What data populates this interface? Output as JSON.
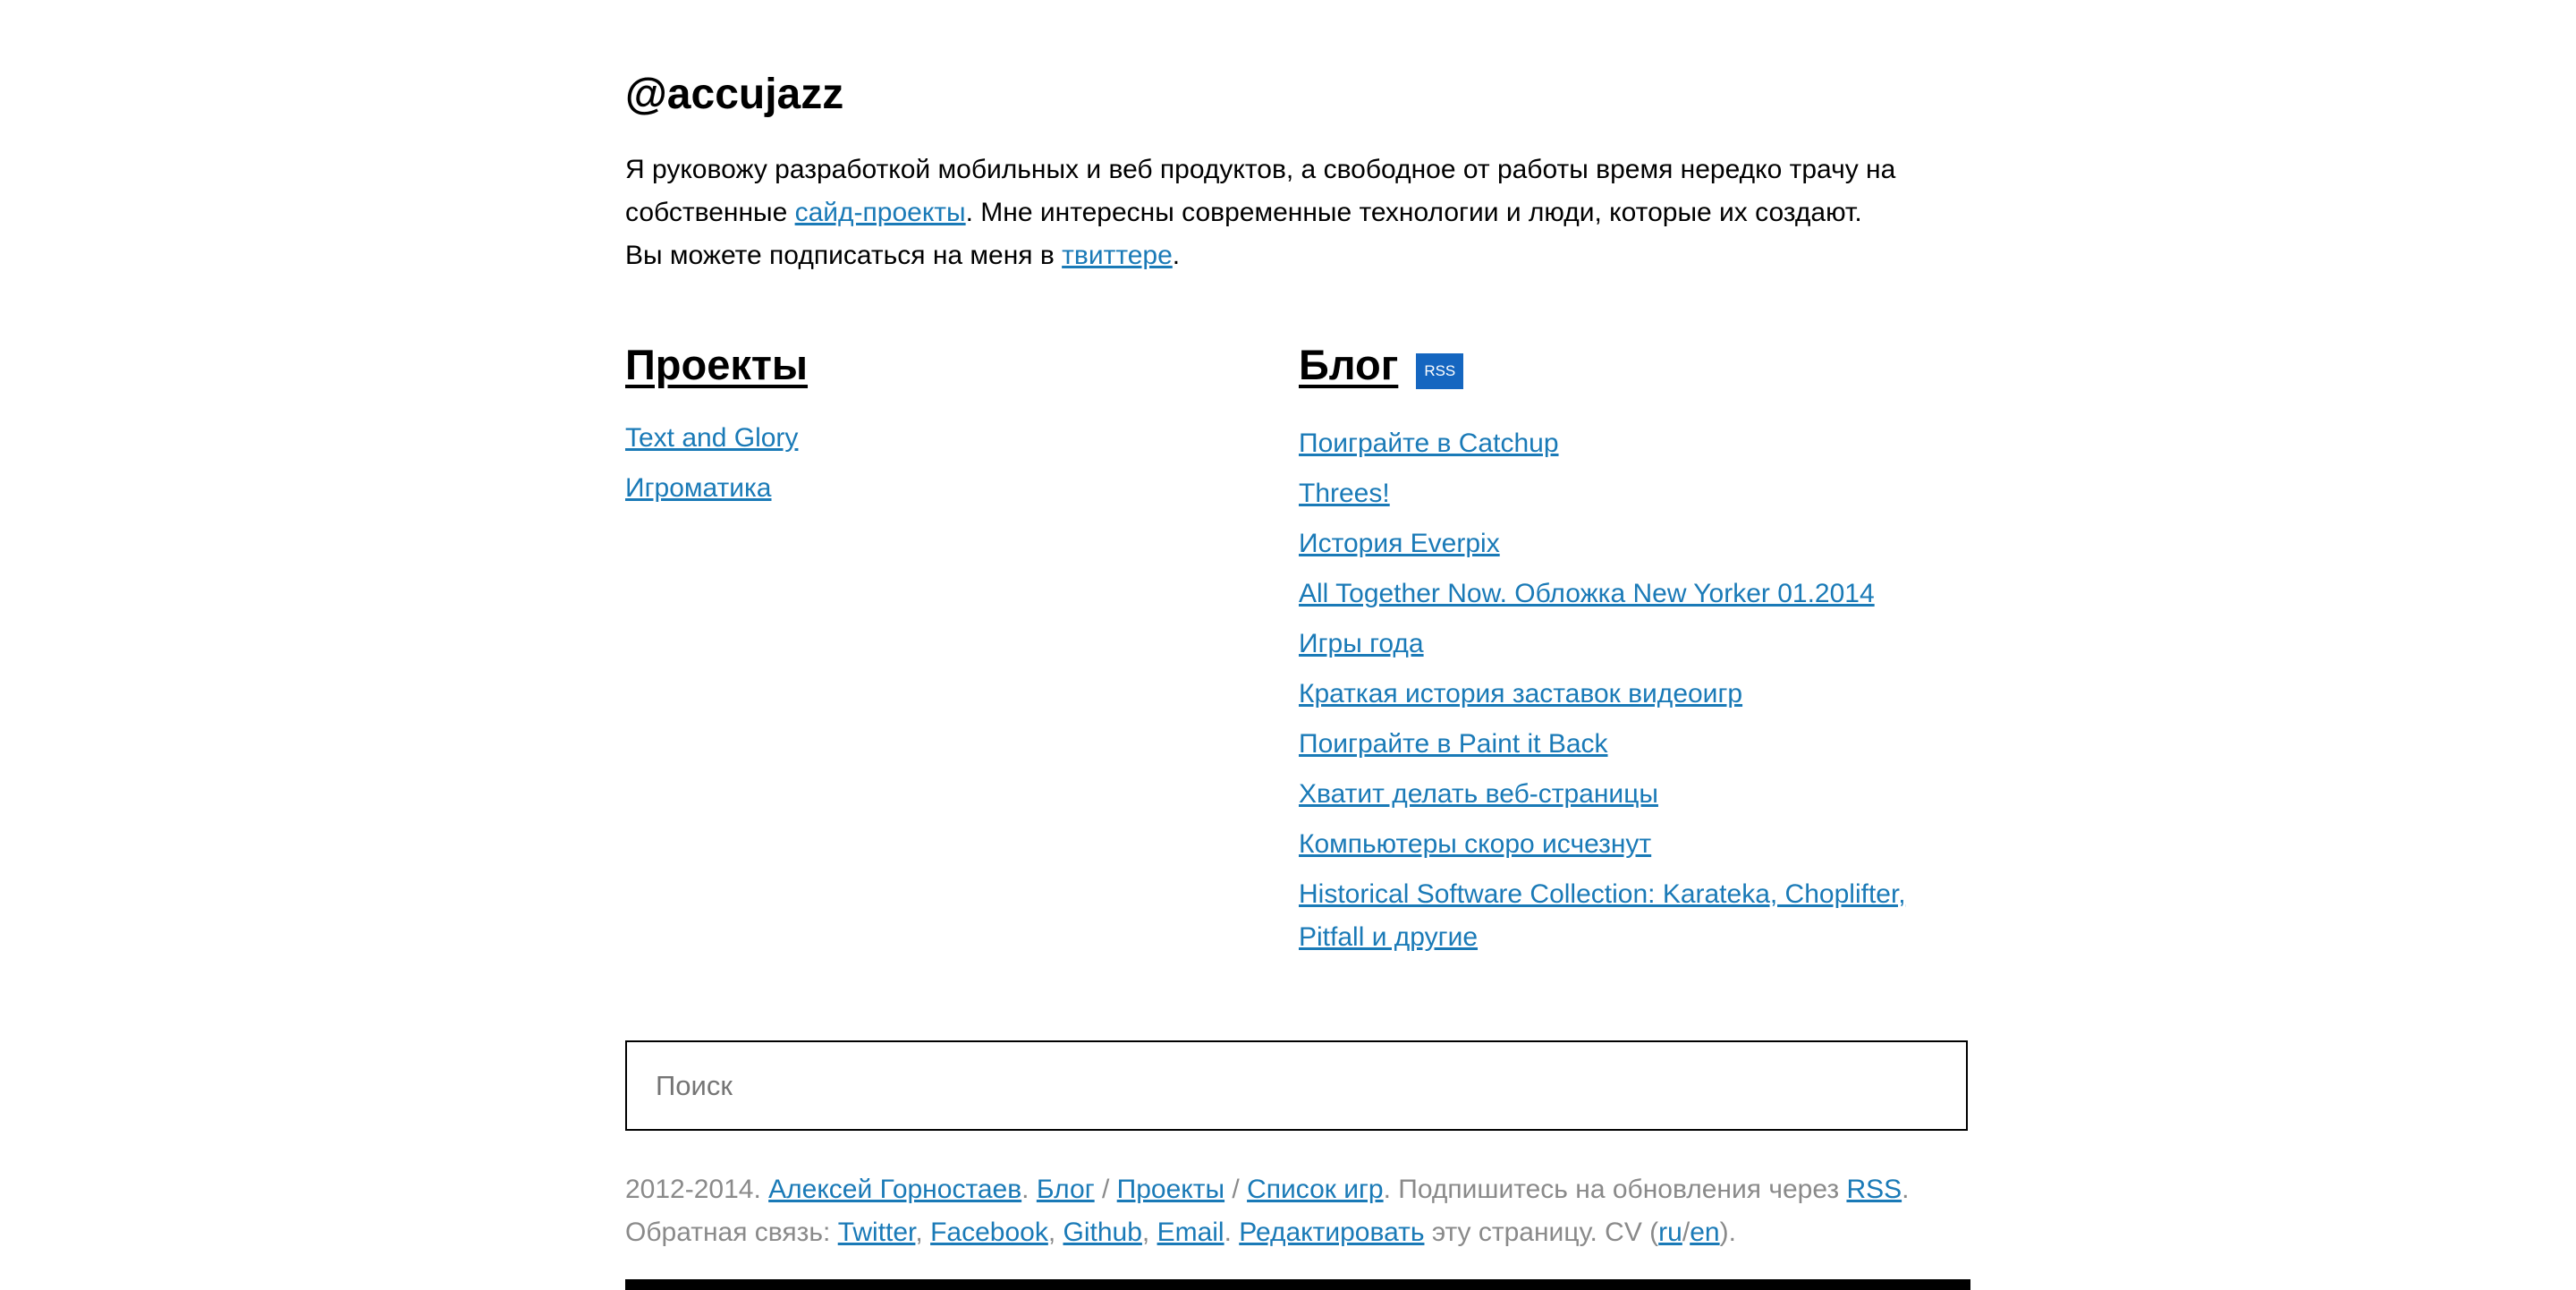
{
  "header": {
    "title": "@accujazz"
  },
  "intro": {
    "text_1": "Я руковожу разработкой мобильных и веб продуктов, а свободное от работы время нередко трачу на собственные ",
    "link_side_projects": "сайд-проекты",
    "text_2": ". Мне интересны современные технологии и люди, которые их создают. Вы можете подписаться на меня в ",
    "link_twitter": "твиттере",
    "text_3": "."
  },
  "projects": {
    "heading": "Проекты",
    "items": [
      "Text and Glory",
      "Игроматика"
    ]
  },
  "blog": {
    "heading": "Блог",
    "rss_badge": "RSS",
    "posts": [
      "Поиграйте в Catchup",
      "Threes!",
      "История Everpix",
      "All Together Now. Обложка New Yorker 01.2014",
      "Игры года",
      "Краткая история заставок видеоигр",
      "Поиграйте в Paint it Back",
      "Хватит делать веб-страницы",
      "Компьютеры скоро исчезнут",
      "Historical Software Collection: Karateka, Choplifter, Pitfall и другие"
    ]
  },
  "search": {
    "placeholder": "Поиск"
  },
  "footer": {
    "years": "2012-2014. ",
    "author": "Алексей Горностаев",
    "sep_dot_1": ". ",
    "blog": "Блог",
    "slash_1": " / ",
    "projects": "Проекты",
    "slash_2": " / ",
    "games_list": "Список игр",
    "subscribe_text": ". Подпишитесь на обновления через ",
    "rss": "RSS",
    "dot_2": ".",
    "feedback_label": "Обратная связь: ",
    "twitter": "Twitter",
    "comma_1": ", ",
    "facebook": "Facebook",
    "comma_2": ", ",
    "github": "Github",
    "comma_3": ", ",
    "email": "Email",
    "dot_3": ". ",
    "edit": "Редактировать",
    "edit_suffix": " эту страницу. CV (",
    "cv_ru": "ru",
    "cv_slash": "/",
    "cv_en": "en",
    "cv_close": ")."
  },
  "colors": {
    "link": "#1a7ab7",
    "rss_badge_bg": "#1566c0",
    "footer_text": "#8a8a8a"
  }
}
